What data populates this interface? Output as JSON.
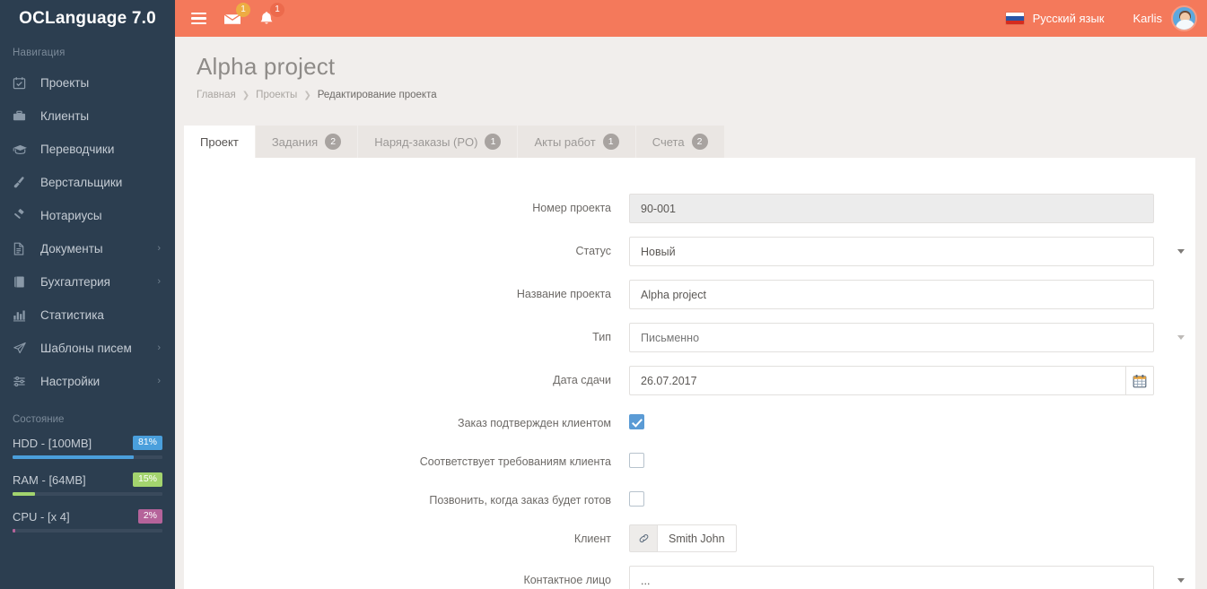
{
  "brand": {
    "title": "OCLanguage 7.0"
  },
  "sidebar": {
    "nav_heading": "Навигация",
    "items": [
      {
        "label": "Проекты",
        "icon": "calendar-check-icon",
        "caret": ""
      },
      {
        "label": "Клиенты",
        "icon": "briefcase-icon",
        "caret": ""
      },
      {
        "label": "Переводчики",
        "icon": "graduation-cap-icon",
        "caret": ""
      },
      {
        "label": "Верстальщики",
        "icon": "paint-brush-icon",
        "caret": ""
      },
      {
        "label": "Нотариусы",
        "icon": "gavel-icon",
        "caret": ""
      },
      {
        "label": "Документы",
        "icon": "file-text-icon",
        "caret": "›"
      },
      {
        "label": "Бухгалтерия",
        "icon": "book-icon",
        "caret": "›"
      },
      {
        "label": "Статистика",
        "icon": "bar-chart-icon",
        "caret": ""
      },
      {
        "label": "Шаблоны писем",
        "icon": "paper-plane-icon",
        "caret": "›"
      },
      {
        "label": "Настройки",
        "icon": "sliders-icon",
        "caret": "›"
      }
    ],
    "state_heading": "Состояние",
    "meters": [
      {
        "label": "HDD - [100MB]",
        "value": "81%",
        "percent": 81,
        "bar_color": "#4a9fdc",
        "badge_color": "#4a9fdc"
      },
      {
        "label": "RAM - [64MB]",
        "value": "15%",
        "percent": 15,
        "bar_color": "#a3d46e",
        "badge_color": "#a3d46e"
      },
      {
        "label": "CPU - [x 4]",
        "value": "2%",
        "percent": 2,
        "bar_color": "#b5639a",
        "badge_color": "#b5639a"
      }
    ]
  },
  "topbar": {
    "menu_icon": "hamburger-icon",
    "messages": {
      "icon": "envelope-icon",
      "count": "1"
    },
    "notifications": {
      "icon": "bell-icon",
      "count": "1"
    },
    "language": {
      "flag": "russia-flag-icon",
      "label": "Русский язык"
    },
    "user": {
      "name": "Karlis",
      "avatar": "user-avatar"
    },
    "accent_color": "#f4795b"
  },
  "page": {
    "title": "Alpha project",
    "breadcrumbs": [
      {
        "label": "Главная",
        "current": false
      },
      {
        "label": "Проекты",
        "current": false
      },
      {
        "label": "Редактирование проекта",
        "current": true
      }
    ]
  },
  "tabs": [
    {
      "label": "Проект",
      "count": "",
      "active": true
    },
    {
      "label": "Задания",
      "count": "2",
      "active": false
    },
    {
      "label": "Наряд-заказы (PO)",
      "count": "1",
      "active": false
    },
    {
      "label": "Акты работ",
      "count": "1",
      "active": false
    },
    {
      "label": "Счета",
      "count": "2",
      "active": false
    }
  ],
  "form": {
    "project_number": {
      "label": "Номер проекта",
      "value": "90-001"
    },
    "status": {
      "label": "Статус",
      "value": "Новый"
    },
    "project_name": {
      "label": "Название проекта",
      "value": "Alpha project"
    },
    "type": {
      "label": "Тип",
      "value": "",
      "placeholder": "Письменно"
    },
    "due_date": {
      "label": "Дата сдачи",
      "value": "26.07.2017",
      "icon": "calendar-icon"
    },
    "order_confirmed": {
      "label": "Заказ подтвержден клиентом",
      "checked": true
    },
    "meets_reqs": {
      "label": "Соответствует требованиям клиента",
      "checked": false
    },
    "call_when_ready": {
      "label": "Позвонить, когда заказ будет готов",
      "checked": false
    },
    "client": {
      "label": "Клиент",
      "value": "Smith John",
      "icon": "link-icon"
    },
    "contact_person": {
      "label": "Контактное лицо",
      "value": "..."
    }
  }
}
